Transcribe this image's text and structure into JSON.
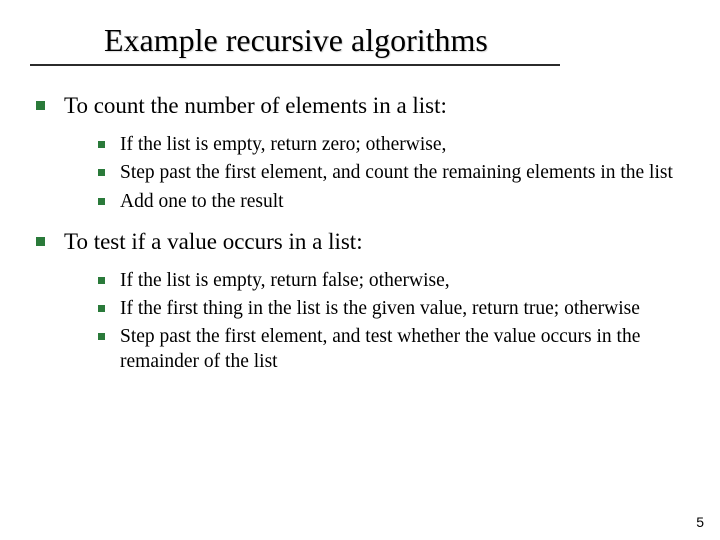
{
  "title": "Example recursive algorithms",
  "sections": [
    {
      "heading": "To count the number of elements in a list:",
      "items": [
        "If the list is empty, return zero; otherwise,",
        "Step past the first element, and count the remaining elements in the list",
        "Add one to the result"
      ]
    },
    {
      "heading": "To test if a value occurs in a list:",
      "items": [
        "If the list is empty, return false; otherwise,",
        "If the first thing in the list is the given value, return true; otherwise",
        "Step past the first element, and test whether the value occurs in the remainder of the list"
      ]
    }
  ],
  "page_number": "5"
}
